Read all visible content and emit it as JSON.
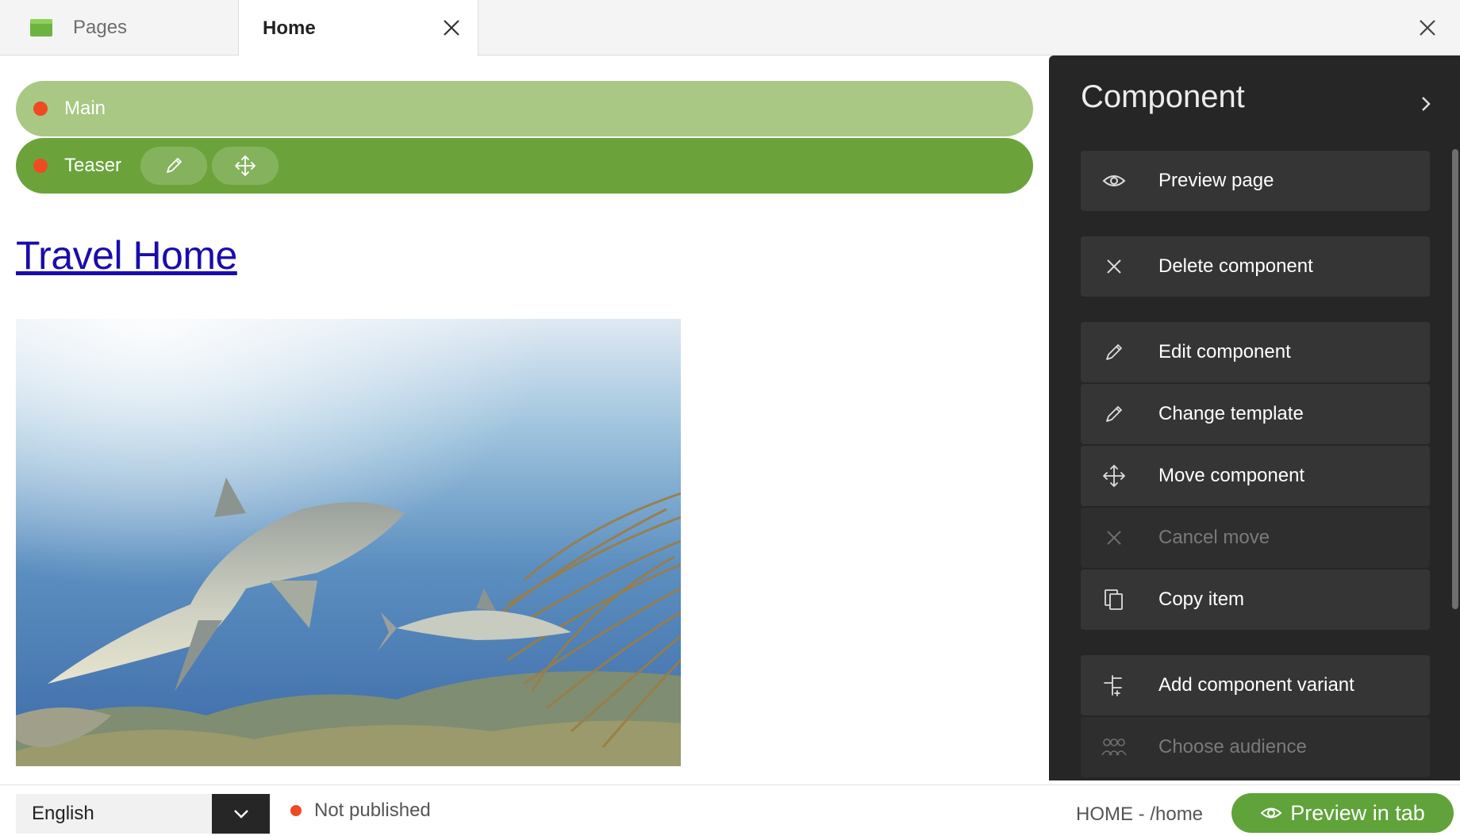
{
  "tabs": {
    "pages_label": "Pages",
    "home_label": "Home"
  },
  "canvas": {
    "main_bar_label": "Main",
    "teaser_bar_label": "Teaser",
    "link_title": "Travel Home"
  },
  "panel": {
    "title": "Component",
    "items": [
      {
        "label": "Preview page",
        "icon": "eye-icon",
        "enabled": true
      },
      {
        "label": "Delete component",
        "icon": "close-icon",
        "enabled": true
      },
      {
        "label": "Edit component",
        "icon": "pencil-icon",
        "enabled": true
      },
      {
        "label": "Change template",
        "icon": "pencil-icon",
        "enabled": true
      },
      {
        "label": "Move component",
        "icon": "move-icon",
        "enabled": true
      },
      {
        "label": "Cancel move",
        "icon": "close-icon",
        "enabled": false
      },
      {
        "label": "Copy item",
        "icon": "copy-icon",
        "enabled": true
      },
      {
        "label": "Add component variant",
        "icon": "variant-icon",
        "enabled": true
      },
      {
        "label": "Choose audience",
        "icon": "audience-icon",
        "enabled": false
      }
    ]
  },
  "bottom": {
    "language": "English",
    "status": "Not published",
    "path": "HOME - /home",
    "preview_button": "Preview in tab"
  },
  "colors": {
    "main_bar": "#a8c883",
    "teaser_bar": "#6ba33a",
    "status_dot": "#f04a23",
    "panel_bg": "#262626",
    "preview_button": "#5fa33a",
    "link": "#1a0dab"
  }
}
